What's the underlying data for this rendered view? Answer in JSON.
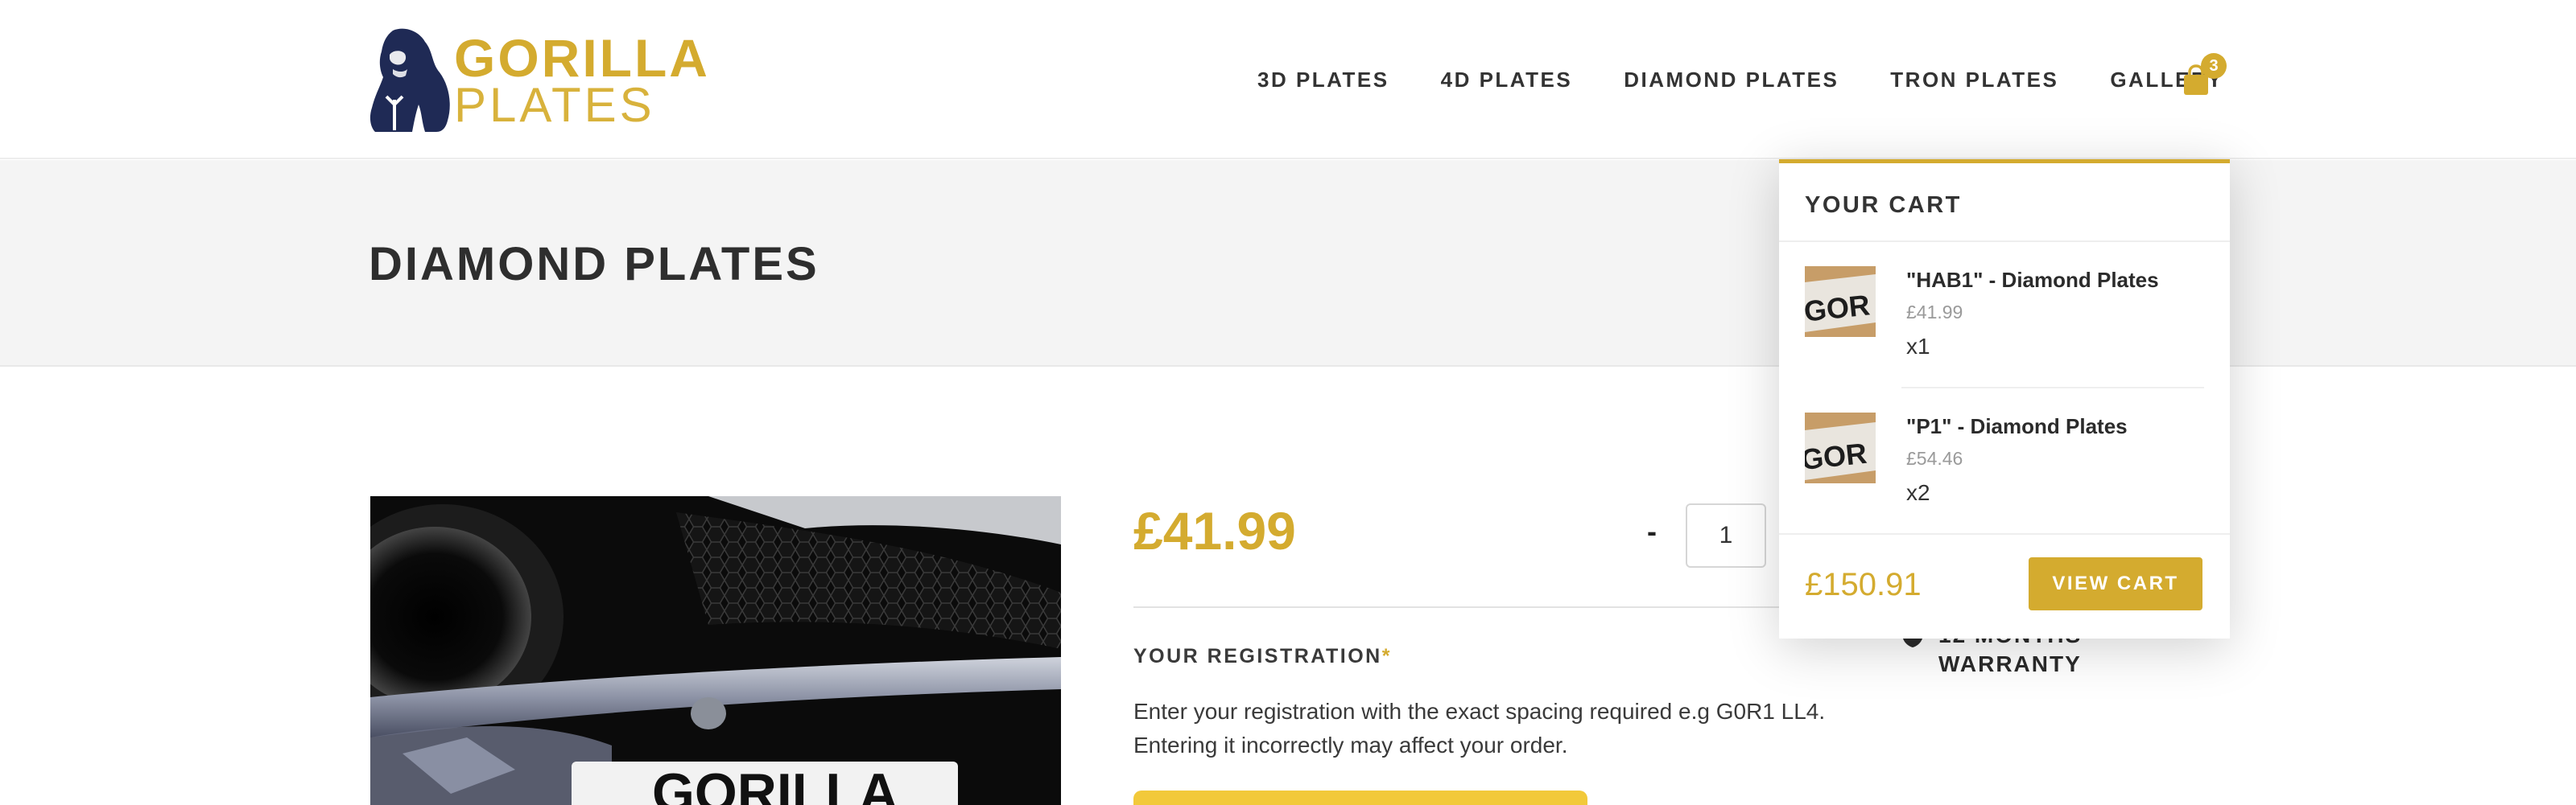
{
  "brand": {
    "line1": "GORILLA",
    "line2": "PLATES",
    "accent_color": "#d4ab2f",
    "icon": "gorilla-logo-icon"
  },
  "nav": {
    "items": [
      "3D PLATES",
      "4D PLATES",
      "DIAMOND PLATES",
      "TRON PLATES",
      "GALLERY"
    ]
  },
  "cart_button": {
    "icon": "shopping-bag-icon",
    "count": "3"
  },
  "page": {
    "title": "DIAMOND PLATES"
  },
  "product": {
    "price": "£41.99",
    "quantity": {
      "minus_label": "-",
      "value": "1"
    },
    "registration": {
      "label": "YOUR REGISTRATION",
      "required_mark": "*",
      "help": "Enter your registration with the exact spacing required e.g G0R1 LL4. Entering it incorrectly may affect your order."
    },
    "warranty": {
      "line1": "12 MONTHS",
      "line2": "WARRANTY",
      "icon": "shield-check-icon"
    }
  },
  "cart": {
    "heading": "YOUR CART",
    "items": [
      {
        "name": "\"HAB1\" - Diamond Plates",
        "price": "£41.99",
        "qty": "x1"
      },
      {
        "name": "\"P1\" - Diamond Plates",
        "price": "£54.46",
        "qty": "x2"
      }
    ],
    "total": "£150.91",
    "view_cart_label": "VIEW CART"
  }
}
